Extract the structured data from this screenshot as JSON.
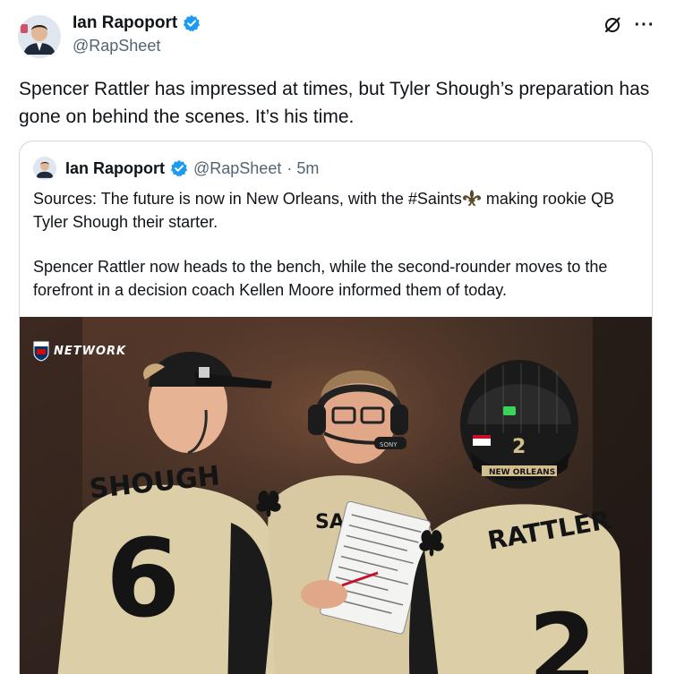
{
  "post": {
    "author_name": "Ian Rapoport",
    "author_handle": "@RapSheet",
    "text": "Spencer Rattler has impressed at times, but Tyler Shough’s preparation has gone on behind the scenes. It’s his time."
  },
  "actions": {
    "grok_icon": "slash-circle-icon",
    "more_label": "···"
  },
  "quoted": {
    "author_name": "Ian Rapoport",
    "author_handle": "@RapSheet",
    "time": "· 5m",
    "text_part1_a": "Sources: The future is now in New Orleans, with the #Saints",
    "text_part1_b": " making rookie QB Tyler Shough their starter.",
    "text_part2": "Spencer Rattler now heads to the bench, while the second-rounder moves to the forefront in a decision coach Kellen Moore informed them of today.",
    "media": {
      "watermark": "NETWORK",
      "jersey_left_name": "SHOUGH",
      "jersey_left_number": "6",
      "jersey_right_name": "RATTLER",
      "jersey_right_number": "2",
      "helmet_number": "2",
      "helmet_strip": "NEW ORLEANS",
      "headset_brand": "SONY",
      "shirt_text": "SA"
    }
  },
  "colors": {
    "verified_blue": "#1d9bf0",
    "secondary_text": "#536471",
    "border": "#cfd9de",
    "saints_gold": "#d3bc8d"
  }
}
